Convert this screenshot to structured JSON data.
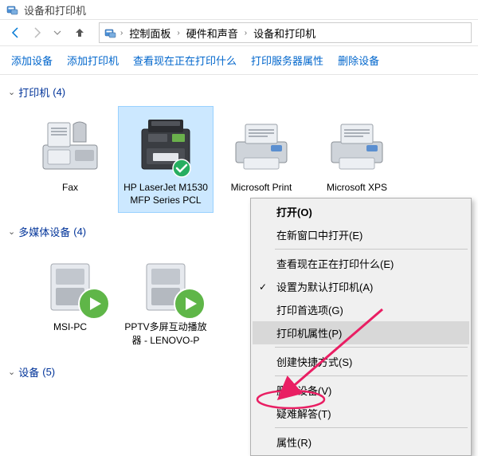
{
  "titlebar": {
    "title": "设备和打印机"
  },
  "breadcrumb": {
    "items": [
      "控制面板",
      "硬件和声音",
      "设备和打印机"
    ]
  },
  "toolbar": {
    "add_device": "添加设备",
    "add_printer": "添加打印机",
    "see_printing": "查看现在正在打印什么",
    "server_props": "打印服务器属性",
    "remove_device": "删除设备"
  },
  "sections": {
    "printers": {
      "label": "打印机",
      "count": "(4)"
    },
    "multimedia": {
      "label": "多媒体设备",
      "count": "(4)"
    },
    "devices": {
      "label": "设备",
      "count": "(5)"
    }
  },
  "printers": [
    {
      "label": "Fax"
    },
    {
      "label": "HP LaserJet M1530 MFP Series PCL"
    },
    {
      "label": "Microsoft Print"
    },
    {
      "label": "Microsoft XPS"
    }
  ],
  "multimedia": [
    {
      "label": "MSI-PC"
    },
    {
      "label": "PPTV多屏互动播放器 - LENOVO-P"
    }
  ],
  "context_menu": {
    "open": "打开(O)",
    "open_new_window": "在新窗口中打开(E)",
    "see_printing": "查看现在正在打印什么(E)",
    "set_default": "设置为默认打印机(A)",
    "print_prefs": "打印首选项(G)",
    "printer_props": "打印机属性(P)",
    "create_shortcut": "创建快捷方式(S)",
    "remove": "删除设备(V)",
    "troubleshoot": "疑难解答(T)",
    "properties": "属性(R)"
  }
}
